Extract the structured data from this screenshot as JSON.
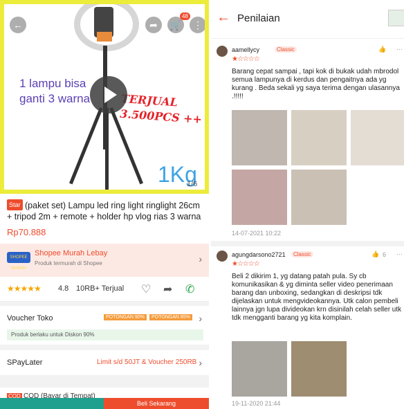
{
  "left": {
    "hero": {
      "overlay_text_1": "1 lampu bisa ganti 3 warna",
      "overlay_text_2": "TERJUAL 3.500PCS ++",
      "weight_label": "1Kg",
      "page_indicator": "1/6",
      "cart_badge": "48",
      "icons": [
        "back-icon",
        "share-icon",
        "cart-icon",
        "more-icon",
        "play-icon"
      ]
    },
    "product": {
      "badge": "Star",
      "title": "(paket set) Lampu led ring light ringlight 26cm + tripod 2m + remote + holder hp vlog rias 3 warna",
      "price": "Rp70.888"
    },
    "shop": {
      "logo_text": "SHOPEE MURAH",
      "name": "Shopee Murah Lebay",
      "subtitle": "Produk termurah di Shopee"
    },
    "rating": {
      "stars": "★★★★★",
      "value": "4.8",
      "sold": "10RB+ Terjual"
    },
    "voucher": {
      "label": "Voucher Toko",
      "chips": [
        "POTONGAN 90%",
        "POTONGAN 85%"
      ],
      "note": "Produk berlaku untuk Diskon 90%"
    },
    "spaylater": {
      "label": "SPayLater",
      "promo": "Limit s/d 50JT & Voucher 250RB"
    },
    "cod": {
      "tag": "COD",
      "text": "COD (Bayar di Tempat)"
    },
    "bottom_bar": {
      "buy_label": "Beli Sekarang"
    }
  },
  "right": {
    "header": {
      "title": "Penilaian"
    },
    "reviews": [
      {
        "username": "aamellycy",
        "badge": "Classic",
        "stars": "★☆☆☆☆",
        "likes": "",
        "text": "Barang cepat sampai , tapi kok di bukak udah mbrodol semua lampunya di kerdus dan pengaitnya ada yg kurang . Beda sekali yg saya terima dengan ulasannya .!!!!!",
        "date": "14-07-2021 10:22"
      },
      {
        "username": "agungdarsono2721",
        "badge": "Classic",
        "stars": "★☆☆☆☆",
        "likes": "6",
        "text": "Beli 2 dikirim 1, yg datang patah pula. Sy cb komunikasikan & yg diminta seller video penerimaan barang dan unboxing, sedangkan di deskripsi tdk dijelaskan untuk mengvideokannya. Utk calon pembeli lainnya jgn lupa divideokan krn disinilah celah seller utk tdk mengganti barang yg kita komplain.",
        "date": "19-11-2020 21:44"
      }
    ]
  }
}
